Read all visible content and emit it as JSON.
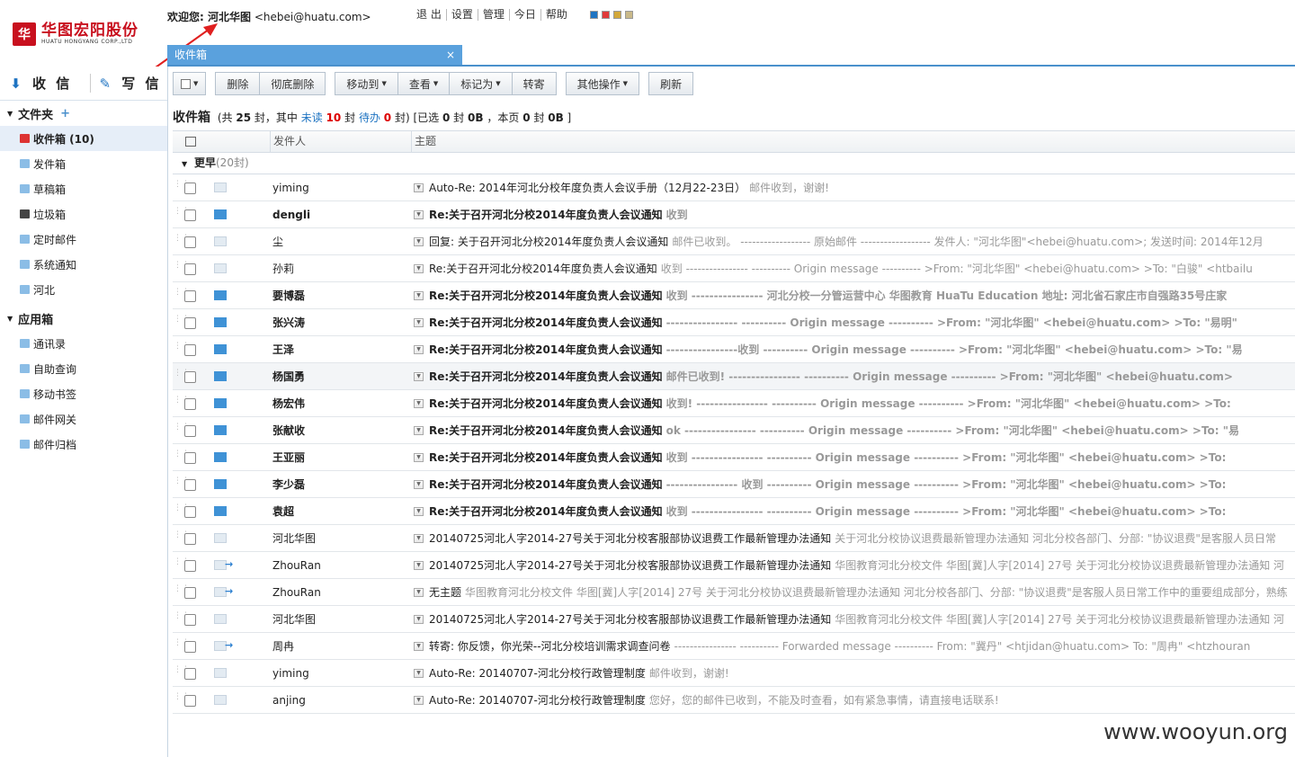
{
  "header": {
    "logo_text": "华图宏阳股份",
    "logo_en": "HUATU HONGYANG CORP.,LTD",
    "welcome_prefix": "欢迎您: ",
    "user_name": "河北华图",
    "user_email": "<hebei@huatu.com>",
    "links": [
      "退 出",
      "设置",
      "管理",
      "今日",
      "帮助"
    ],
    "skins": [
      "#1f74c2",
      "#e03a3a",
      "#d2a73a",
      "#c9b98a"
    ]
  },
  "tab": {
    "label": "收件箱",
    "close": "×"
  },
  "sidebar": {
    "receive_label": "收 信",
    "write_label": "写 信",
    "folders_title": "文件夹",
    "folders": [
      {
        "label": "收件箱 (10)",
        "type": "red",
        "active": true
      },
      {
        "label": "发件箱",
        "type": "normal"
      },
      {
        "label": "草稿箱",
        "type": "normal"
      },
      {
        "label": "垃圾箱",
        "type": "dark"
      },
      {
        "label": "定时邮件",
        "type": "normal"
      },
      {
        "label": "系统通知",
        "type": "normal"
      },
      {
        "label": "河北",
        "type": "normal"
      }
    ],
    "apps_title": "应用箱",
    "apps": [
      "通讯录",
      "自助查询",
      "移动书签",
      "邮件网关",
      "邮件归档"
    ]
  },
  "toolbar": {
    "delete": "删除",
    "delete_forever": "彻底删除",
    "move_to": "移动到",
    "view": "查看",
    "mark_as": "标记为",
    "forward": "转寄",
    "other": "其他操作",
    "refresh": "刷新"
  },
  "summary": {
    "title": "收件箱",
    "t1": "(共",
    "total": "25",
    "t2": "封，其中",
    "unread_label": "未读",
    "unread": "10",
    "t3": "封",
    "pending_label": "待办",
    "pending": "0",
    "t4": "封) [已选",
    "selected": "0",
    "t5": "封",
    "selected_size": "0B",
    "t6": "，本页",
    "page_count": "0",
    "t7": "封",
    "page_size": "0B",
    "t8": "]"
  },
  "list": {
    "col_sender": "发件人",
    "col_subject": "主题",
    "group_label": "更早",
    "group_count": "(20封)",
    "rows": [
      {
        "sender": "yiming",
        "subject": "Auto-Re: 2014年河北分校年度负责人会议手册（12月22-23日）",
        "preview": "邮件收到，谢谢!",
        "state": "read"
      },
      {
        "sender": "dengli",
        "subject": "Re:关于召开河北分校2014年度负责人会议通知",
        "preview": "收到",
        "state": "unread"
      },
      {
        "sender": "尘",
        "subject": "回复: 关于召开河北分校2014年度负责人会议通知",
        "preview": "邮件已收到。 ------------------ 原始邮件 ------------------ 发件人: \"河北华图\"<hebei@huatu.com>; 发送时间: 2014年12月",
        "state": "read"
      },
      {
        "sender": "孙莉",
        "subject": "Re:关于召开河北分校2014年度负责人会议通知",
        "preview": "收到 ---------------- ---------- Origin message ---------- >From: \"河北华图\" <hebei@huatu.com> >To: \"白骏\" <htbailu",
        "state": "read"
      },
      {
        "sender": "要博磊",
        "subject": "Re:关于召开河北分校2014年度负责人会议通知",
        "preview": "收到 ---------------- 河北分校一分管运营中心 华图教育 HuaTu Education 地址: 河北省石家庄市自强路35号庄家",
        "state": "unread"
      },
      {
        "sender": "张兴涛",
        "subject": "Re:关于召开河北分校2014年度负责人会议通知",
        "preview": "---------------- ---------- Origin message ---------- >From: \"河北华图\" <hebei@huatu.com> >To: \"易明\"",
        "state": "unread"
      },
      {
        "sender": "王泽",
        "subject": "Re:关于召开河北分校2014年度负责人会议通知",
        "preview": "----------------收到 ---------- Origin message ---------- >From: \"河北华图\" <hebei@huatu.com> >To: \"易",
        "state": "unread"
      },
      {
        "sender": "杨国勇",
        "subject": "Re:关于召开河北分校2014年度负责人会议通知",
        "preview": "邮件已收到! ---------------- ---------- Origin message ---------- >From: \"河北华图\" <hebei@huatu.com>",
        "state": "unread",
        "hl": true
      },
      {
        "sender": "杨宏伟",
        "subject": "Re:关于召开河北分校2014年度负责人会议通知",
        "preview": "收到! ---------------- ---------- Origin message ---------- >From: \"河北华图\" <hebei@huatu.com> >To:",
        "state": "unread"
      },
      {
        "sender": "张献收",
        "subject": "Re:关于召开河北分校2014年度负责人会议通知",
        "preview": "ok ---------------- ---------- Origin message ---------- >From: \"河北华图\" <hebei@huatu.com> >To: \"易",
        "state": "unread"
      },
      {
        "sender": "王亚丽",
        "subject": "Re:关于召开河北分校2014年度负责人会议通知",
        "preview": "收到 ---------------- ---------- Origin message ---------- >From: \"河北华图\" <hebei@huatu.com> >To:",
        "state": "unread"
      },
      {
        "sender": "李少磊",
        "subject": "Re:关于召开河北分校2014年度负责人会议通知",
        "preview": "---------------- 收到 ---------- Origin message ---------- >From: \"河北华图\" <hebei@huatu.com> >To:",
        "state": "unread"
      },
      {
        "sender": "袁超",
        "subject": "Re:关于召开河北分校2014年度负责人会议通知",
        "preview": "收到 ---------------- ---------- Origin message ---------- >From: \"河北华图\" <hebei@huatu.com> >To:",
        "state": "unread"
      },
      {
        "sender": "河北华图",
        "subject": "20140725河北人字2014-27号关于河北分校客服部协议退费工作最新管理办法通知",
        "preview": "关于河北分校协议退费最新管理办法通知 河北分校各部门、分部: \"协议退费\"是客服人员日常",
        "state": "read"
      },
      {
        "sender": "ZhouRan",
        "subject": "20140725河北人字2014-27号关于河北分校客服部协议退费工作最新管理办法通知",
        "preview": "华图教育河北分校文件 华图[冀]人字[2014] 27号 关于河北分校协议退费最新管理办法通知 河",
        "state": "fwd"
      },
      {
        "sender": "ZhouRan",
        "subject": "无主题",
        "preview": "华图教育河北分校文件 华图[冀]人字[2014] 27号 关于河北分校协议退费最新管理办法通知 河北分校各部门、分部: \"协议退费\"是客服人员日常工作中的重要组成部分，熟练",
        "state": "fwd"
      },
      {
        "sender": "河北华图",
        "subject": "20140725河北人字2014-27号关于河北分校客服部协议退费工作最新管理办法通知",
        "preview": "华图教育河北分校文件 华图[冀]人字[2014] 27号 关于河北分校协议退费最新管理办法通知 河",
        "state": "read"
      },
      {
        "sender": "周冉",
        "subject": "转寄: 你反馈，你光荣--河北分校培训需求调查问卷",
        "preview": "---------------- ---------- Forwarded message ---------- From: \"冀丹\" <htjidan@huatu.com> To: \"周冉\" <htzhouran",
        "state": "fwd"
      },
      {
        "sender": "yiming",
        "subject": "Auto-Re: 20140707-河北分校行政管理制度",
        "preview": "邮件收到，谢谢!",
        "state": "read"
      },
      {
        "sender": "anjing",
        "subject": "Auto-Re: 20140707-河北分校行政管理制度",
        "preview": "您好，您的邮件已收到，不能及时查看，如有紧急事情，请直接电话联系!",
        "state": "read"
      }
    ]
  },
  "watermark": "www.wooyun.org"
}
